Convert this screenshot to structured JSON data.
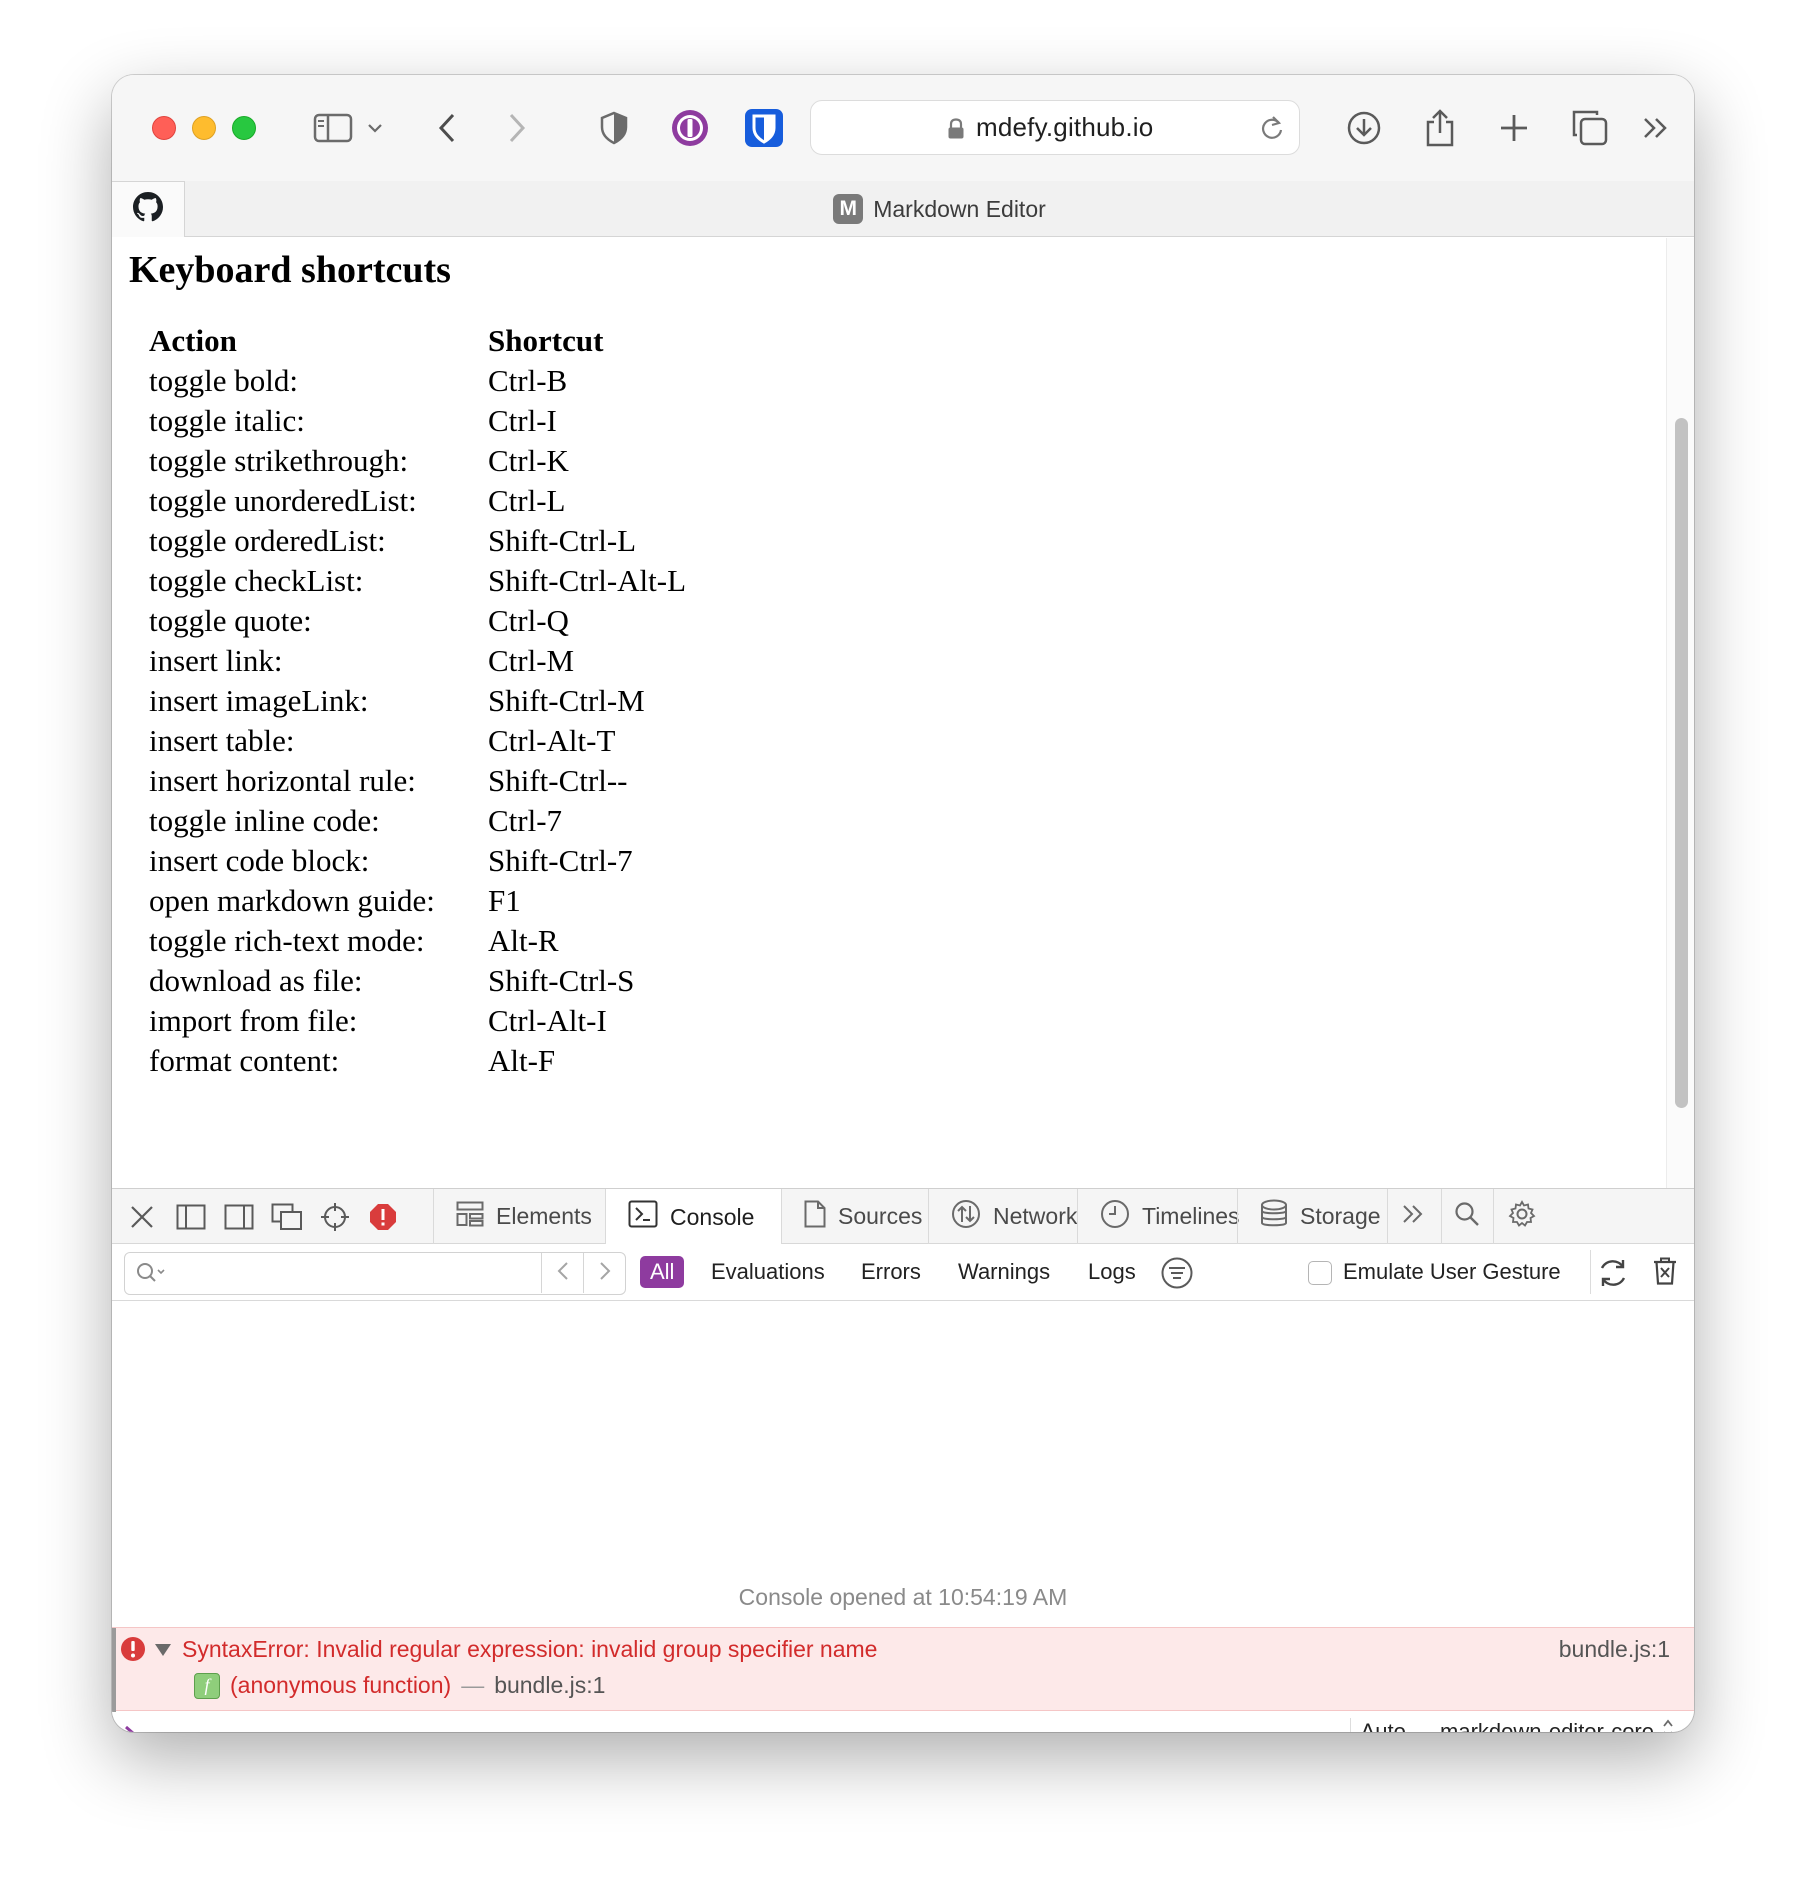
{
  "browser": {
    "url": "mdefy.github.io",
    "tab_title": "Markdown Editor",
    "favicon_letter": "M",
    "accent_colors": {
      "onepassword": "#8e3b9f",
      "bitwarden": "#175ddc",
      "close": "#ff5f57",
      "minimize": "#febc2e",
      "zoom": "#28c840"
    }
  },
  "page": {
    "title": "Keyboard shortcuts",
    "table": {
      "headers": [
        "Action",
        "Shortcut"
      ],
      "rows": [
        [
          "toggle bold:",
          "Ctrl-B"
        ],
        [
          "toggle italic:",
          "Ctrl-I"
        ],
        [
          "toggle strikethrough:",
          "Ctrl-K"
        ],
        [
          "toggle unorderedList:",
          "Ctrl-L"
        ],
        [
          "toggle orderedList:",
          "Shift-Ctrl-L"
        ],
        [
          "toggle checkList:",
          "Shift-Ctrl-Alt-L"
        ],
        [
          "toggle quote:",
          "Ctrl-Q"
        ],
        [
          "insert link:",
          "Ctrl-M"
        ],
        [
          "insert imageLink:",
          "Shift-Ctrl-M"
        ],
        [
          "insert table:",
          "Ctrl-Alt-T"
        ],
        [
          "insert horizontal rule:",
          "Shift-Ctrl--"
        ],
        [
          "toggle inline code:",
          "Ctrl-7"
        ],
        [
          "insert code block:",
          "Shift-Ctrl-7"
        ],
        [
          "open markdown guide:",
          "F1"
        ],
        [
          "toggle rich-text mode:",
          "Alt-R"
        ],
        [
          "download as file:",
          "Shift-Ctrl-S"
        ],
        [
          "import from file:",
          "Ctrl-Alt-I"
        ],
        [
          "format content:",
          "Alt-F"
        ]
      ]
    }
  },
  "devtools": {
    "tabs": {
      "elements": "Elements",
      "console": "Console",
      "sources": "Sources",
      "network": "Network",
      "timelines": "Timelines",
      "storage": "Storage"
    },
    "filter": {
      "placeholder": "",
      "levels": {
        "all": "All",
        "evaluations": "Evaluations",
        "errors": "Errors",
        "warnings": "Warnings",
        "logs": "Logs"
      },
      "emulate_label": "Emulate User Gesture"
    },
    "console": {
      "opened_text": "Console opened at 10:54:19 AM",
      "error": {
        "message": "SyntaxError: Invalid regular expression: invalid group specifier name",
        "source": "bundle.js:1",
        "trace_function": "(anonymous function)",
        "trace_separator": "—",
        "trace_file": "bundle.js:1",
        "fn_badge": "f"
      },
      "context": "Auto — markdown-editor-core"
    }
  }
}
